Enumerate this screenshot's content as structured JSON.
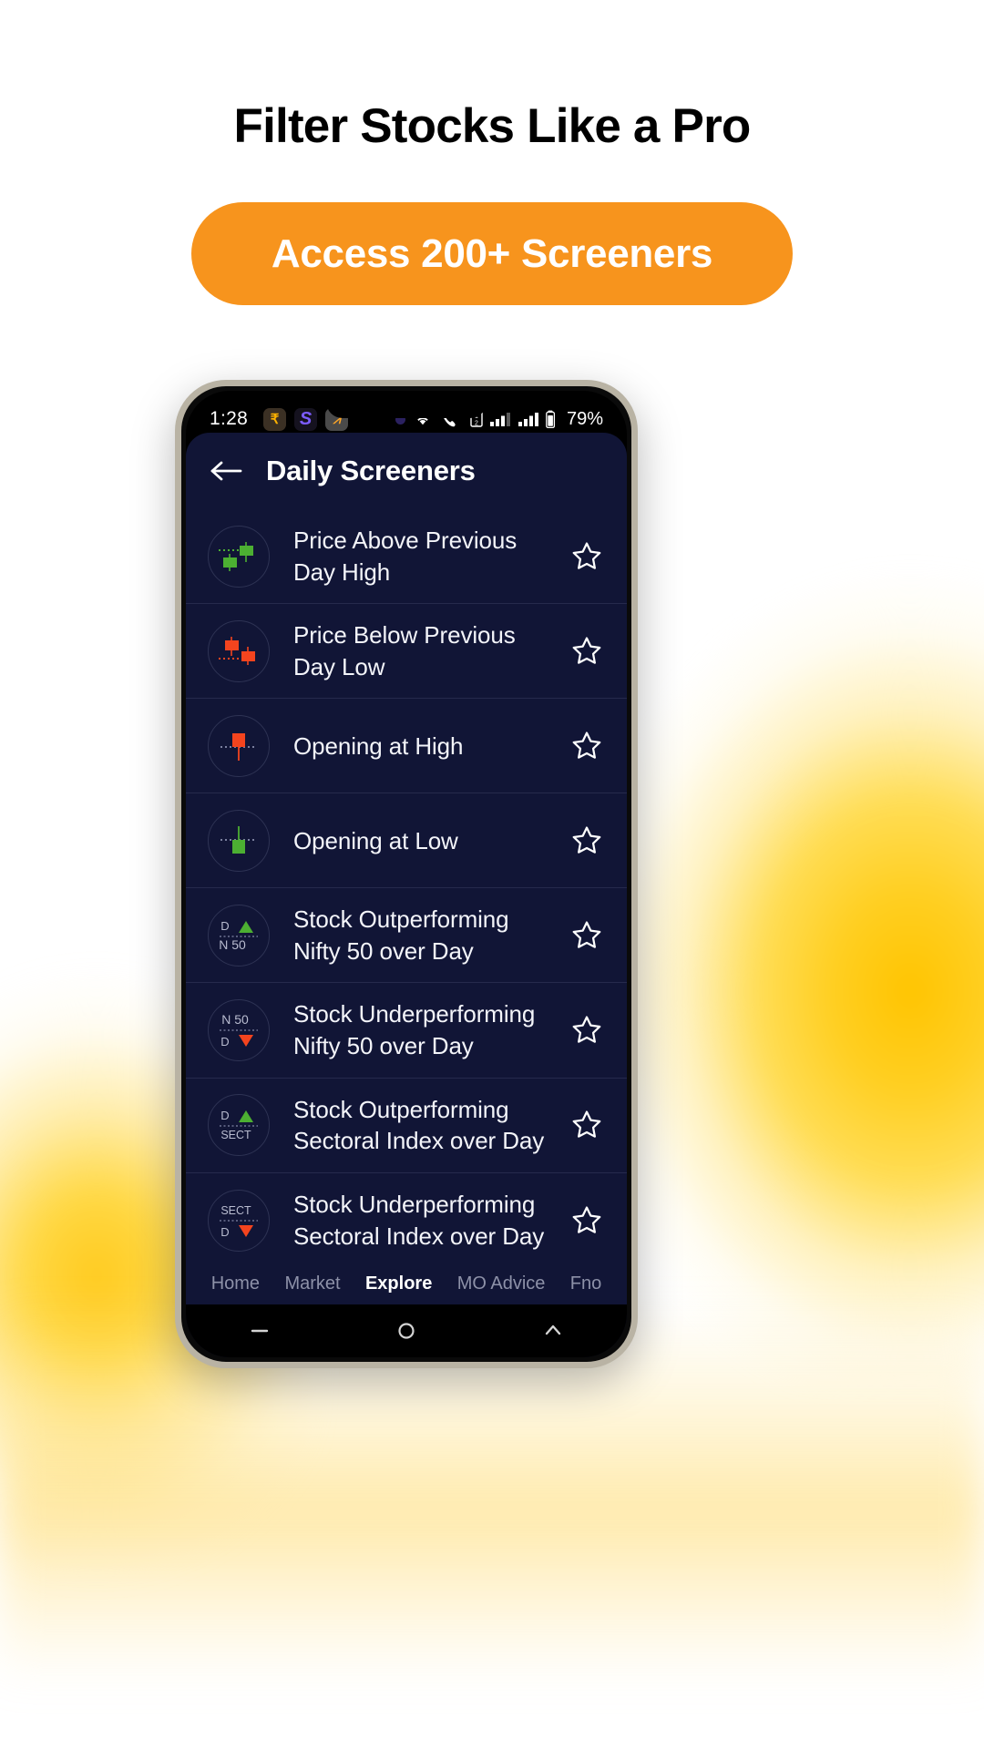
{
  "promo": {
    "headline": "Filter Stocks Like a Pro",
    "cta_label": "Access 200+ Screeners",
    "accent_color": "#f7941d",
    "headline_color": "#000000"
  },
  "phone": {
    "statusbar": {
      "time": "1:28",
      "app_icons": [
        "rupee-icon",
        "snapchat-icon",
        "moneywise-icon"
      ],
      "right_icons": [
        "purple-dot-icon",
        "wifi-icon",
        "call-wifi-icon",
        "sim-dual-icon",
        "signal-icon",
        "signal-icon"
      ],
      "battery": "79%"
    },
    "app": {
      "header": {
        "back_icon": "back-arrow-icon",
        "title": "Daily Screeners"
      },
      "screeners": [
        {
          "label": "Price Above Previous Day High",
          "icon": "candles-up-icon",
          "starred": false
        },
        {
          "label": "Price Below Previous Day Low",
          "icon": "candles-down-icon",
          "starred": false
        },
        {
          "label": "Opening at High",
          "icon": "candle-open-high-icon",
          "starred": false
        },
        {
          "label": "Opening at Low",
          "icon": "candle-open-low-icon",
          "starred": false
        },
        {
          "label": "Stock Outperforming Nifty 50 over Day",
          "icon": "badge-d-n50-up-icon",
          "badge_top": "D",
          "badge_bottom": "N 50",
          "direction": "up",
          "starred": false
        },
        {
          "label": "Stock Underperforming Nifty 50 over Day",
          "icon": "badge-n50-d-down-icon",
          "badge_top": "N 50",
          "badge_bottom": "D",
          "direction": "down",
          "starred": false
        },
        {
          "label": "Stock Outperforming Sectoral Index over Day",
          "icon": "badge-d-sect-up-icon",
          "badge_top": "D",
          "badge_bottom": "SECT",
          "direction": "up",
          "starred": false
        },
        {
          "label": "Stock Underperforming Sectoral Index over Day",
          "icon": "badge-sect-d-down-icon",
          "badge_top": "SECT",
          "badge_bottom": "D",
          "direction": "down",
          "starred": false
        }
      ],
      "bottom_nav": [
        {
          "label": "Home",
          "active": false
        },
        {
          "label": "Market",
          "active": false
        },
        {
          "label": "Explore",
          "active": true
        },
        {
          "label": "MO Advice",
          "active": false
        },
        {
          "label": "Fno",
          "active": false
        }
      ]
    },
    "android_nav": [
      "recents-icon",
      "home-icon",
      "back-icon"
    ]
  },
  "colors": {
    "bullish_green": "#4caf32",
    "bearish_red": "#f4441e",
    "app_bg": "#111536",
    "divider": "#262a4c"
  }
}
